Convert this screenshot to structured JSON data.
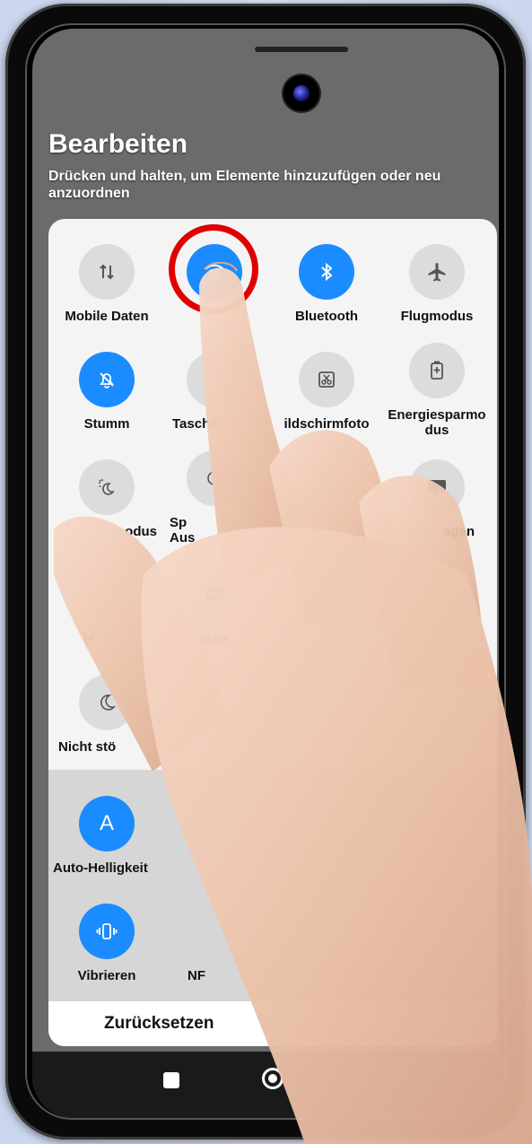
{
  "header": {
    "title": "Bearbeiten",
    "subtitle": "Drücken und halten, um Elemente hinzuzufügen oder neu anzuordnen"
  },
  "tiles": [
    {
      "label": "Mobile Daten",
      "icon": "mobile-data-icon",
      "active": false
    },
    {
      "label": "",
      "icon": "wifi-icon",
      "active": true
    },
    {
      "label": "Bluetooth",
      "icon": "bluetooth-icon",
      "active": true
    },
    {
      "label": "Flugmodus",
      "icon": "airplane-icon",
      "active": false
    },
    {
      "label": "Stumm",
      "icon": "mute-bell-icon",
      "active": true
    },
    {
      "label": "Tasche",
      "icon": "flashlight-icon",
      "active": false
    },
    {
      "label": "ildschirmfoto",
      "icon": "screenshot-icon",
      "active": false
    },
    {
      "label": "Energiesparmo dus",
      "icon": "battery-saver-icon",
      "active": false
    },
    {
      "label": "odus",
      "icon": "dark-mode-icon",
      "active": false
    },
    {
      "label": "Sp Aus",
      "icon": "eye-icon",
      "active": false
    },
    {
      "label": "agen",
      "icon": "cast-icon",
      "active": false
    },
    {
      "label": "H",
      "icon": "hotspot-icon",
      "active": false
    },
    {
      "label": "Walle",
      "icon": "wallet-icon",
      "active": false
    },
    {
      "label": "Nicht stö",
      "icon": "moon-icon",
      "active": false
    },
    {
      "label": "Auto-Helligkeit",
      "icon": "auto-brightness-icon",
      "active": true
    },
    {
      "label": "Vibrieren",
      "icon": "vibrate-icon",
      "active": true
    },
    {
      "label": "NF",
      "icon": "nfc-icon",
      "active": false
    }
  ],
  "footer": {
    "reset_label": "Zurücksetzen"
  },
  "colors": {
    "accent": "#1a8cff",
    "highlight_ring": "#e00000",
    "panel": "#f4f4f4",
    "lower_panel": "#d6d6d6"
  }
}
